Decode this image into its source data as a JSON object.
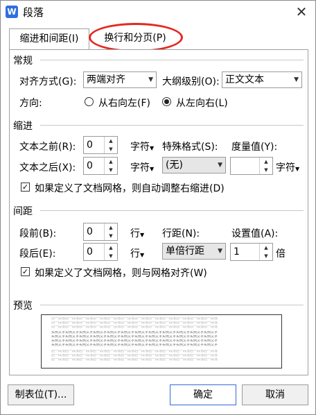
{
  "window": {
    "title": "段落",
    "icon_letter": "W"
  },
  "tabs": [
    {
      "label": "缩进和间距(I)"
    },
    {
      "label": "换行和分页(P)"
    }
  ],
  "general": {
    "heading": "常规",
    "align_label": "对齐方式(G):",
    "align_value": "两端对齐",
    "outline_label": "大纲级别(O):",
    "outline_value": "正文文本",
    "direction_label": "方向:",
    "rtl_label": "从右向左(F)",
    "ltr_label": "从左向右(L)"
  },
  "indent": {
    "heading": "缩进",
    "before_label": "文本之前(R):",
    "before_value": "0",
    "after_label": "文本之后(X):",
    "after_value": "0",
    "unit": "字符",
    "special_label": "特殊格式(S):",
    "special_value": "(无)",
    "measure_label": "度量值(Y):",
    "measure_value": "",
    "measure_unit": "字符",
    "auto_adjust_label": "如果定义了文档网格，则自动调整右缩进(D)"
  },
  "spacing": {
    "heading": "间距",
    "before_label": "段前(B):",
    "before_value": "0",
    "after_label": "段后(E):",
    "after_value": "0",
    "unit": "行",
    "line_label": "行距(N):",
    "line_value": "单倍行距",
    "setting_label": "设置值(A):",
    "setting_value": "1",
    "setting_unit": "倍",
    "snap_label": "如果定义了文档网格，则与网格对齐(W)"
  },
  "preview": {
    "heading": "预览",
    "prev_text": "前一段落前一段落前一段落前一段落前一段落前一段落前一段落前一段落前一段落前一段落前一段落前一段落",
    "sample_text": "实例文字实例文字实例文字实例文字实例文字实例文字实例文字实例文字实例文字实例文字实例文字实例文字",
    "next_text": "后一段落后一段落后一段落后一段落后一段落后一段落后一段落后一段落后一段落后一段落后一段落后一段落"
  },
  "footer": {
    "tabs_button": "制表位(T)...",
    "ok_button": "确定",
    "cancel_button": "取消"
  },
  "colors": {
    "accent": "#2e6bd6",
    "highlight_oval": "#e4281f"
  }
}
